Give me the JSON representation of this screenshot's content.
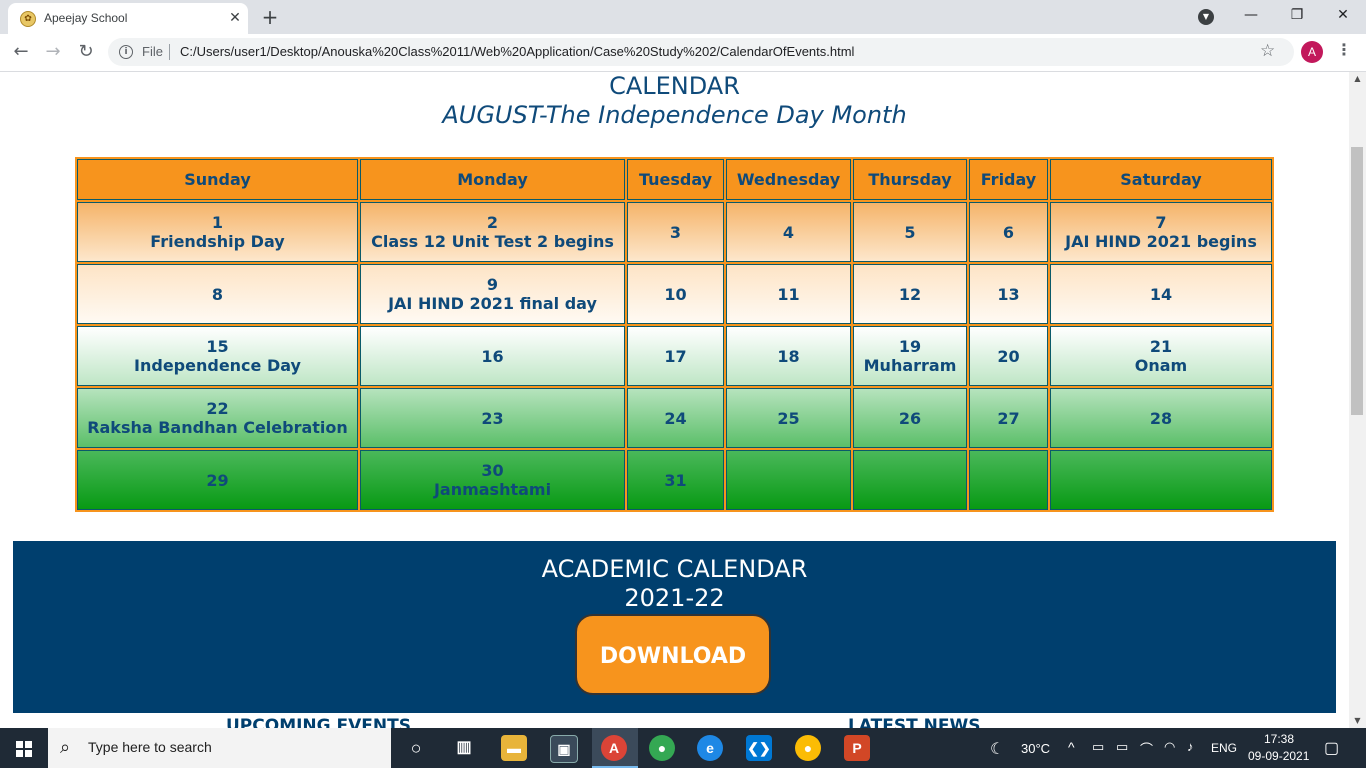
{
  "browser": {
    "tab_title": "Apeejay School",
    "scheme": "File",
    "url": "C:/Users/user1/Desktop/Anouska%20Class%2011/Web%20Application/Case%20Study%202/CalendarOfEvents.html",
    "avatar_letter": "A"
  },
  "page": {
    "heading": "CALENDAR",
    "subheading": "AUGUST-The Independence Day Month",
    "weekdays": [
      "Sunday",
      "Monday",
      "Tuesday",
      "Wednesday",
      "Thursday",
      "Friday",
      "Saturday"
    ],
    "weeks": [
      [
        {
          "day": "1",
          "event": "Friendship Day"
        },
        {
          "day": "2",
          "event": "Class 12 Unit Test 2 begins"
        },
        {
          "day": "3",
          "event": ""
        },
        {
          "day": "4",
          "event": ""
        },
        {
          "day": "5",
          "event": ""
        },
        {
          "day": "6",
          "event": ""
        },
        {
          "day": "7",
          "event": "JAI HIND 2021 begins"
        }
      ],
      [
        {
          "day": "8",
          "event": ""
        },
        {
          "day": "9",
          "event": "JAI HIND 2021 final day"
        },
        {
          "day": "10",
          "event": ""
        },
        {
          "day": "11",
          "event": ""
        },
        {
          "day": "12",
          "event": ""
        },
        {
          "day": "13",
          "event": ""
        },
        {
          "day": "14",
          "event": ""
        }
      ],
      [
        {
          "day": "15",
          "event": "Independence Day"
        },
        {
          "day": "16",
          "event": ""
        },
        {
          "day": "17",
          "event": ""
        },
        {
          "day": "18",
          "event": ""
        },
        {
          "day": "19",
          "event": "Muharram"
        },
        {
          "day": "20",
          "event": ""
        },
        {
          "day": "21",
          "event": "Onam"
        }
      ],
      [
        {
          "day": "22",
          "event": "Raksha Bandhan Celebration"
        },
        {
          "day": "23",
          "event": ""
        },
        {
          "day": "24",
          "event": ""
        },
        {
          "day": "25",
          "event": ""
        },
        {
          "day": "26",
          "event": ""
        },
        {
          "day": "27",
          "event": ""
        },
        {
          "day": "28",
          "event": ""
        }
      ],
      [
        {
          "day": "29",
          "event": ""
        },
        {
          "day": "30",
          "event": "Janmashtami"
        },
        {
          "day": "31",
          "event": ""
        },
        {
          "day": "",
          "event": ""
        },
        {
          "day": "",
          "event": ""
        },
        {
          "day": "",
          "event": ""
        },
        {
          "day": "",
          "event": ""
        }
      ]
    ],
    "academic": {
      "title": "ACADEMIC CALENDAR",
      "year": "2021-22",
      "download_label": "DOWNLOAD"
    },
    "upcoming_events_label": "UPCOMING EVENTS",
    "latest_news_label": "LATEST NEWS"
  },
  "taskbar": {
    "search_placeholder": "Type here to search",
    "temperature": "30°C",
    "language": "ENG",
    "time": "17:38",
    "date": "09-09-2021"
  },
  "colors": {
    "accent_orange": "#f7941d",
    "navy": "#003f6e",
    "text_blue": "#0f4a7a",
    "green": "#089a14"
  }
}
